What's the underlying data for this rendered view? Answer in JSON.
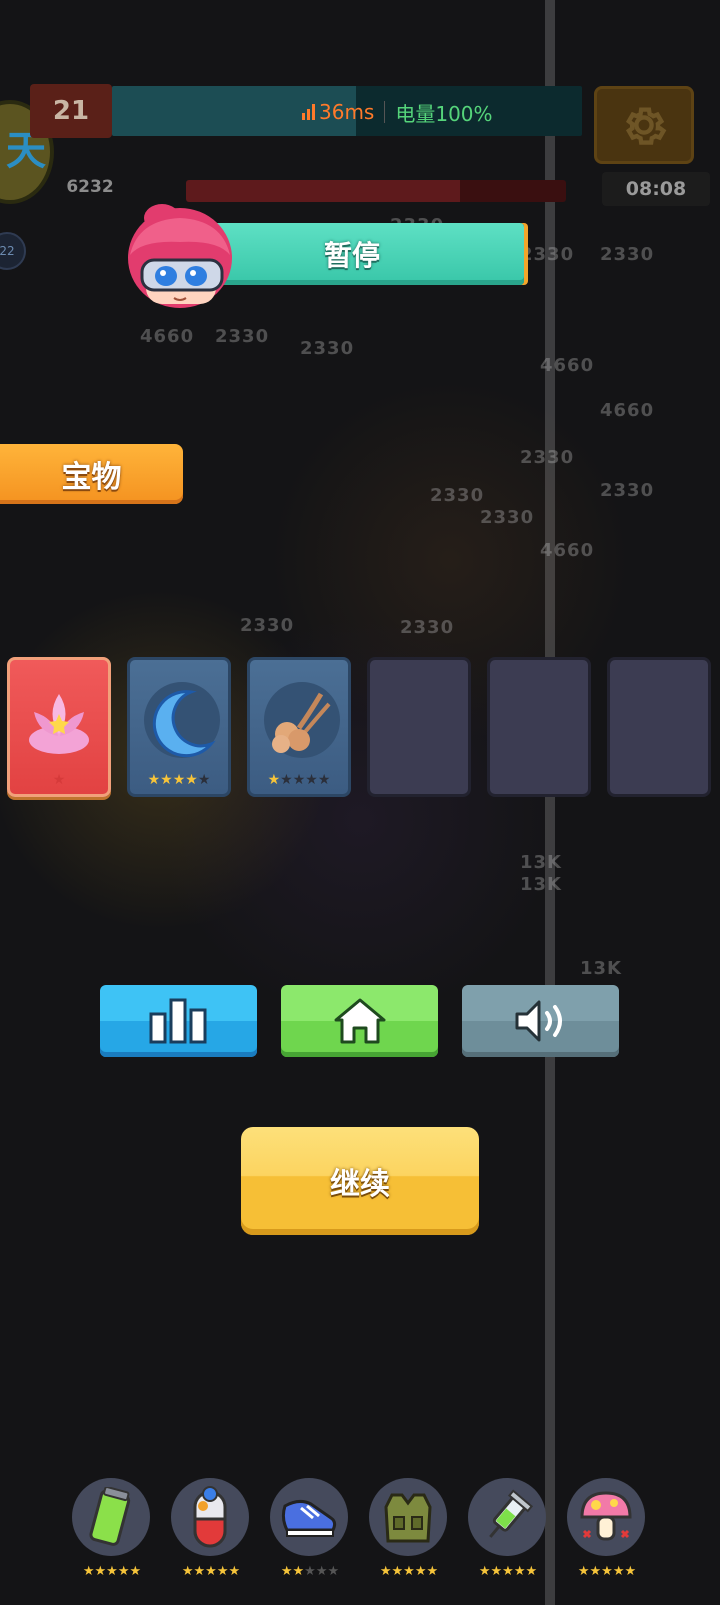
{
  "hud": {
    "level": "21",
    "xp_progress": 0.52,
    "ping": "36ms",
    "battery": "电量100%",
    "coins": "6232",
    "timer": "08:08",
    "boss_hp": 0.72,
    "badge_glyph": "天",
    "side_circle": "22"
  },
  "floating_numbers": [
    "2330",
    "2330",
    "2330",
    "4660",
    "2330",
    "2330",
    "2330",
    "4660",
    "4660",
    "2330",
    "2330",
    "2330",
    "2330",
    "4660",
    "2330",
    "13K",
    "13K",
    "13K",
    "2330"
  ],
  "pause": {
    "title": "暂停"
  },
  "treasure": {
    "tab_label": "宝物"
  },
  "items": [
    {
      "type": "lotus",
      "color": "red",
      "stars": 1,
      "max_stars": 1
    },
    {
      "type": "crescent-moon",
      "color": "blue",
      "stars": 4,
      "max_stars": 5
    },
    {
      "type": "dust-cloud",
      "color": "blue",
      "stars": 1,
      "max_stars": 5
    },
    {
      "type": "empty",
      "color": "empty"
    },
    {
      "type": "empty",
      "color": "empty"
    },
    {
      "type": "empty",
      "color": "empty"
    }
  ],
  "controls": {
    "stats_icon": "bar-chart-icon",
    "home_icon": "home-icon",
    "sound_icon": "speaker-icon"
  },
  "continue": {
    "label": "继续"
  },
  "equipment": [
    {
      "name": "battery-canister",
      "stars": 5
    },
    {
      "name": "capsule-pill",
      "stars": 5
    },
    {
      "name": "sneaker",
      "stars": 2
    },
    {
      "name": "tactical-vest",
      "stars": 5
    },
    {
      "name": "syringe",
      "stars": 5
    },
    {
      "name": "mushroom",
      "stars": 5
    }
  ],
  "colors": {
    "pause_banner": "#38c6a8",
    "treasure_tab": "#f49220",
    "continue_button": "#f6bf36",
    "stats_button": "#26a7e6",
    "home_button": "#6fd64e",
    "sound_button": "#6e8e9a"
  }
}
